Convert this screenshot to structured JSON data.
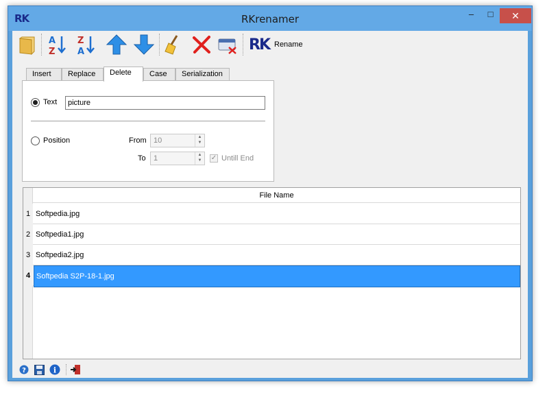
{
  "window": {
    "title": "RKrenamer",
    "app_icon_text": "RK",
    "minimize_glyph": "–",
    "maximize_glyph": "□",
    "close_glyph": "✕"
  },
  "toolbar": {
    "buttons": [
      {
        "name": "open-folder-icon"
      },
      {
        "name": "sort-ascending-icon",
        "glyph_top": "A",
        "glyph_bottom": "Z"
      },
      {
        "name": "sort-descending-icon",
        "glyph_top": "Z",
        "glyph_bottom": "A"
      },
      {
        "name": "move-up-icon"
      },
      {
        "name": "move-down-icon"
      },
      {
        "name": "clear-broom-icon"
      },
      {
        "name": "remove-icon"
      },
      {
        "name": "clear-list-icon"
      }
    ],
    "rename_logo": "RK",
    "rename_label": "Rename"
  },
  "tabs": [
    {
      "label": "Insert",
      "active": false
    },
    {
      "label": "Replace",
      "active": false
    },
    {
      "label": "Delete",
      "active": true
    },
    {
      "label": "Case",
      "active": false
    },
    {
      "label": "Serialization",
      "active": false
    }
  ],
  "delete_panel": {
    "text_option_label": "Text",
    "text_option_selected": true,
    "text_value": "picture",
    "position_option_label": "Position",
    "position_option_selected": false,
    "from_label": "From",
    "from_value": "10",
    "to_label": "To",
    "to_value": "1",
    "until_end_label": "Untill End",
    "until_end_checked": true
  },
  "file_list": {
    "column_header": "File Name",
    "rows": [
      {
        "num": "1",
        "name": "Softpedia.jpg",
        "selected": false
      },
      {
        "num": "2",
        "name": "Softpedia1.jpg",
        "selected": false
      },
      {
        "num": "3",
        "name": "Softpedia2.jpg",
        "selected": false
      },
      {
        "num": "4",
        "name": "Softpedia S2P-18-1.jpg",
        "selected": true
      }
    ]
  },
  "statusbar": {
    "icons": [
      "help-icon",
      "save-icon",
      "info-icon",
      "exit-icon"
    ]
  },
  "colors": {
    "title_bar": "#63a9e6",
    "selection": "#3399ff",
    "close_button": "#c7504a"
  }
}
